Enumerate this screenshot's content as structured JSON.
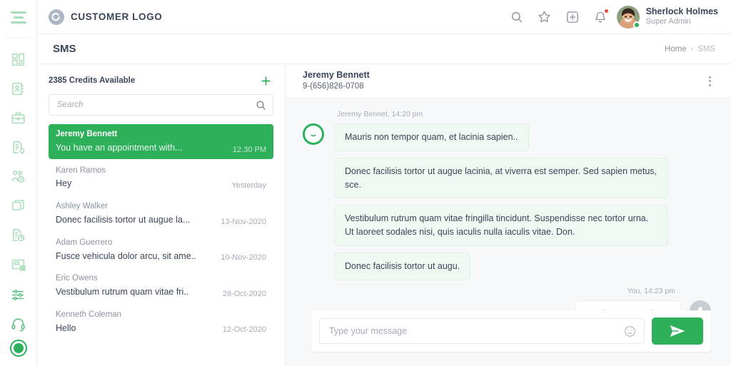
{
  "colors": {
    "brand_green": "#2eb05a",
    "rail_icon_green": "#a8dcb9",
    "text_dark": "#3b4559",
    "text_muted": "#8b93a0",
    "bubble_in_bg": "#f0f8f2",
    "notify_red": "#ef4a3a"
  },
  "rail": {
    "menu_icon": "hamburger-menu-icon",
    "items": [
      {
        "icon": "dashboard-grid-icon",
        "name": "dashboard"
      },
      {
        "icon": "contact-book-icon",
        "name": "contacts"
      },
      {
        "icon": "briefcase-icon",
        "name": "jobs"
      },
      {
        "icon": "document-location-icon",
        "name": "placements"
      },
      {
        "icon": "users-clock-icon",
        "name": "timesheets"
      },
      {
        "icon": "layers-icon",
        "name": "layers"
      },
      {
        "icon": "report-chart-icon",
        "name": "reports"
      },
      {
        "icon": "widgets-icon",
        "name": "widgets"
      }
    ],
    "bottom_items": [
      {
        "icon": "sliders-settings-icon",
        "name": "settings"
      },
      {
        "icon": "headset-support-icon",
        "name": "support"
      }
    ],
    "status_indicator": "active-status-icon"
  },
  "topbar": {
    "brand_mark": "customer-logo-mark",
    "brand_text": "CUSTOMER LOGO",
    "actions": [
      {
        "icon": "search-icon",
        "name": "search"
      },
      {
        "icon": "star-icon",
        "name": "favorites"
      },
      {
        "icon": "plus-square-icon",
        "name": "quick-add"
      },
      {
        "icon": "bell-icon",
        "name": "notifications",
        "has_badge": true
      }
    ],
    "user": {
      "name": "Sherlock Holmes",
      "role": "Super Admin",
      "avatar": "user-avatar",
      "online": true
    }
  },
  "pagehead": {
    "title": "SMS",
    "breadcrumb": {
      "home": "Home",
      "separator": "›",
      "current": "SMS"
    }
  },
  "conversations_panel": {
    "credits_text": "2385 Credits Available",
    "add_icon": "plus-icon",
    "search": {
      "placeholder": "Search",
      "value": "",
      "icon": "search-icon"
    },
    "items": [
      {
        "name": "Jeremy Bennett",
        "preview": "You have an appointment with...",
        "time": "12.30 PM",
        "active": true
      },
      {
        "name": "Karen Ramos",
        "preview": "Hey",
        "time": "Yesterday",
        "active": false
      },
      {
        "name": "Ashley Walker",
        "preview": "Donec facilisis tortor ut augue la...",
        "time": "13-Nov-2020",
        "active": false
      },
      {
        "name": "Adam Guerrero",
        "preview": "Fusce vehicula dolor arcu, sit ame..",
        "time": "10-Nov-2020",
        "active": false
      },
      {
        "name": "Eric Owens",
        "preview": "Vestibulum rutrum quam vitae fri..",
        "time": "28-Oct-2020",
        "active": false
      },
      {
        "name": "Kenneth Coleman",
        "preview": "Hello",
        "time": "12-Oct-2020",
        "active": false
      }
    ]
  },
  "chat": {
    "header": {
      "name": "Jeremy Bennett",
      "phone": "9-(656)826-0708",
      "menu_icon": "kebab-menu-icon"
    },
    "incoming_meta": "Jeremy Bennet, 14:20 pm",
    "outgoing_meta": "You, 14:23 pm",
    "messages_in": [
      "Mauris non tempor quam, et lacinia sapien..",
      "Donec facilisis tortor ut augue lacinia, at viverra est semper. Sed sapien metus, sce.",
      "Vestibulum rutrum quam vitae fringilla tincidunt. Suspendisse nec tortor urna. Ut laoreet sodales nisi, quis iaculis nulla iaculis vitae. Don.",
      "Donec facilisis tortor ut augu."
    ],
    "message_out": "Lead Java Developer",
    "contact_avatar": "contact-smiley-avatar",
    "user_avatar": "person-avatar",
    "composer": {
      "placeholder": "Type your message",
      "value": "",
      "emoji_icon": "emoji-smiley-icon",
      "send_icon": "send-paper-plane-icon"
    }
  }
}
